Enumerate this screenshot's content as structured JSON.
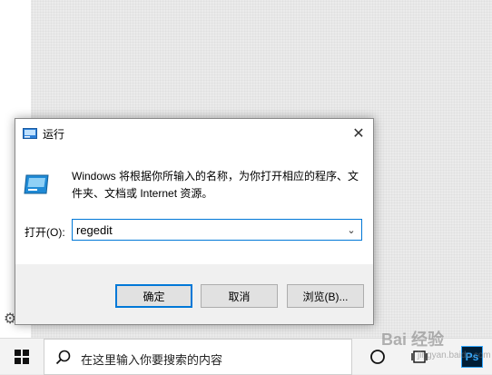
{
  "dialog": {
    "title": "运行",
    "description": "Windows 将根据你所输入的名称，为你打开相应的程序、文件夹、文档或 Internet 资源。",
    "open_label": "打开(O):",
    "input_value": "regedit",
    "buttons": {
      "ok": "确定",
      "cancel": "取消",
      "browse": "浏览(B)..."
    }
  },
  "taskbar": {
    "search_placeholder": "在这里输入你要搜索的内容",
    "ps_label": "Ps"
  },
  "watermark": {
    "text": "Bai 经验",
    "sub": "jingyan.baidu.com"
  },
  "icons": {
    "run": "run-app-icon",
    "close": "close-icon",
    "chevron": "chevron-down-icon",
    "windows": "windows-logo-icon",
    "search": "search-icon",
    "cortana": "cortana-icon",
    "taskview": "task-view-icon",
    "gear": "gear-icon"
  },
  "colors": {
    "accent": "#0078d7",
    "dialog_bg": "#f0f0f0",
    "taskbar_bg": "#f3f3f3"
  }
}
